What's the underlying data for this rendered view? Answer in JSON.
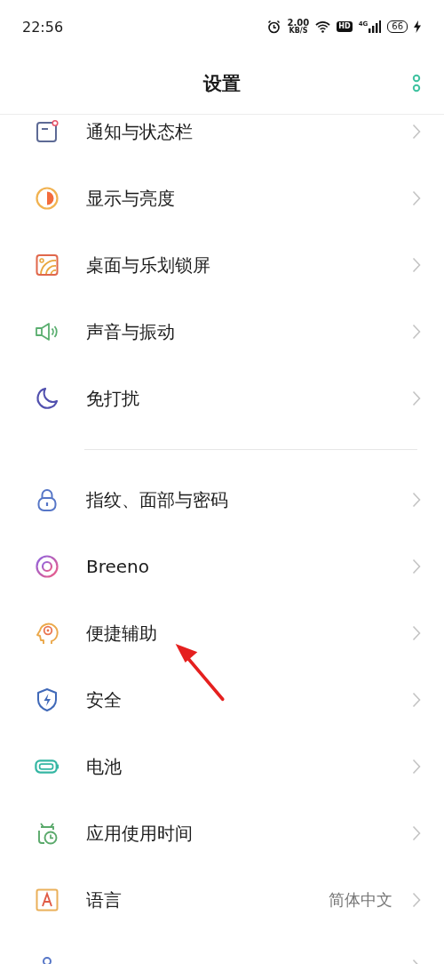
{
  "status_bar": {
    "time": "22:56",
    "speed_value": "2.00",
    "speed_unit": "KB/S",
    "hd_badge": "HD",
    "network": "4G",
    "battery": "66",
    "charging": true
  },
  "header": {
    "title": "设置"
  },
  "sections": [
    {
      "items": [
        {
          "kind": "notification",
          "label": "通知与状态栏"
        },
        {
          "kind": "display",
          "label": "显示与亮度"
        },
        {
          "kind": "wallpaper",
          "label": "桌面与乐划锁屏"
        },
        {
          "kind": "sound",
          "label": "声音与振动"
        },
        {
          "kind": "moon",
          "label": "免打扰"
        }
      ]
    },
    {
      "items": [
        {
          "kind": "lock",
          "label": "指纹、面部与密码"
        },
        {
          "kind": "breeno",
          "label": "Breeno"
        },
        {
          "kind": "head",
          "label": "便捷辅助"
        },
        {
          "kind": "shield",
          "label": "安全"
        },
        {
          "kind": "battery",
          "label": "电池"
        },
        {
          "kind": "clock",
          "label": "应用使用时间"
        },
        {
          "kind": "language",
          "label": "语言",
          "value": "简体中文"
        },
        {
          "kind": "person"
        }
      ]
    }
  ],
  "annotation": {
    "kind": "arrow"
  }
}
